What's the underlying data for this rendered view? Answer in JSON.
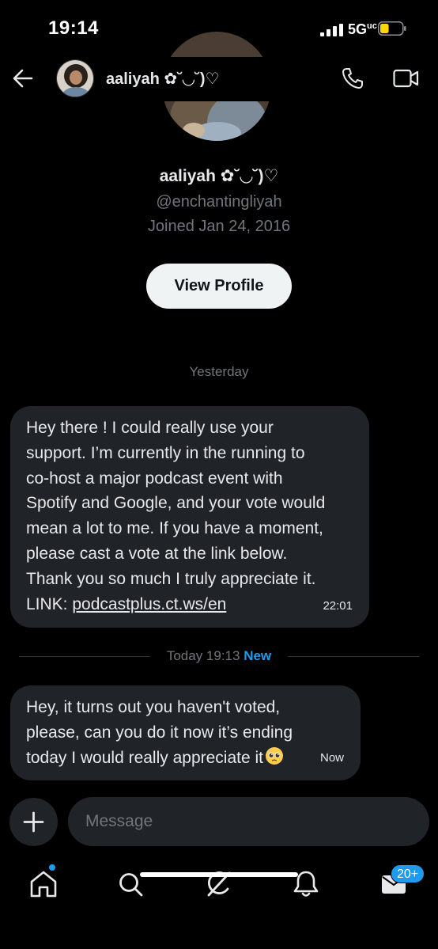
{
  "status_bar": {
    "time": "19:14",
    "network": "5G",
    "battery_level": 0.4,
    "battery_color": "#ffd60a"
  },
  "header": {
    "name": "aaliyah ✿˘◡˘)♡",
    "icons": [
      "back-arrow-icon",
      "phone-icon",
      "video-camera-icon"
    ]
  },
  "profile": {
    "name": "aaliyah ✿˘◡˘)♡",
    "handle": "@enchantingliyah",
    "joined": "Joined Jan 24, 2016",
    "view_profile_label": "View Profile"
  },
  "conversation": {
    "day_label": "Yesterday",
    "messages": [
      {
        "text": "Hey there ! I could really use your\nsupport. I’m currently in the running to\nco-host a major podcast event with\nSpotify and Google, and your vote would\nmean a lot to me. If you have a moment,\nplease cast a vote at the link below.\nThank you so much I truly appreciate it.\nLINK: ",
        "link": "podcastplus.ct.ws/en",
        "time": "22:01"
      },
      {
        "text": "Hey, it turns out you haven't voted,\nplease, can you do it now it’s ending\ntoday I would really appreciate it",
        "emoji": "pleading-face-icon",
        "time": "Now"
      }
    ],
    "divider": {
      "label": "Today 19:13",
      "new_label": "New"
    }
  },
  "composer": {
    "placeholder": "Message",
    "add_icon": "plus-icon"
  },
  "bottom_nav": {
    "items": [
      "home-icon",
      "search-icon",
      "grok-icon",
      "bell-icon",
      "envelope-icon"
    ],
    "messages_badge": "20+",
    "accent_color": "#1d9bf0"
  }
}
